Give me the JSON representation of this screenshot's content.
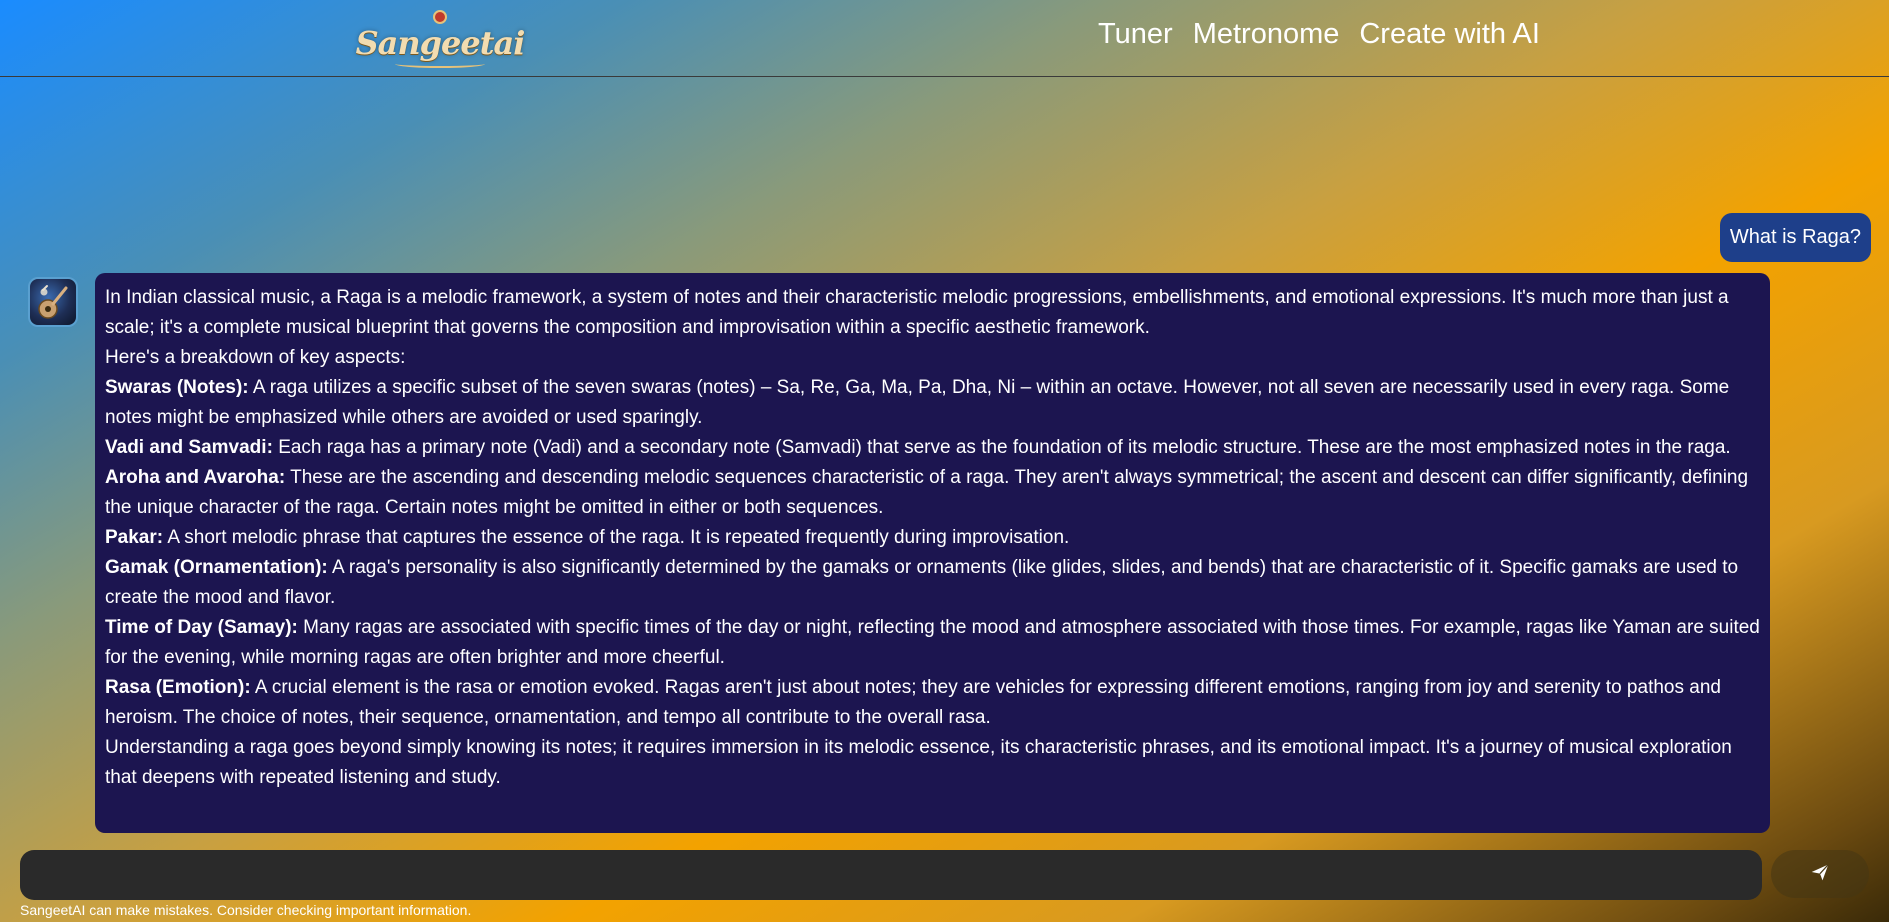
{
  "header": {
    "logo_text": "Sangeetai",
    "nav": [
      {
        "label": "Tuner"
      },
      {
        "label": "Metronome"
      },
      {
        "label": "Create with AI"
      }
    ]
  },
  "chat": {
    "user_message": "What is Raga?",
    "assistant": {
      "avatar_icon": "veena-avatar-icon",
      "intro": "In Indian classical music, a Raga is a melodic framework, a system of notes and their characteristic melodic progressions, embellishments, and emotional expressions. It's much more than just a scale; it's a complete musical blueprint that governs the composition and improvisation within a specific aesthetic framework.",
      "lead": "Here's a breakdown of key aspects:",
      "points": [
        {
          "term": "Swaras (Notes):",
          "text": "A raga utilizes a specific subset of the seven swaras (notes) – Sa, Re, Ga, Ma, Pa, Dha, Ni – within an octave. However, not all seven are necessarily used in every raga. Some notes might be emphasized while others are avoided or used sparingly."
        },
        {
          "term": "Vadi and Samvadi:",
          "text": "Each raga has a primary note (Vadi) and a secondary note (Samvadi) that serve as the foundation of its melodic structure. These are the most emphasized notes in the raga."
        },
        {
          "term": "Aroha and Avaroha:",
          "text": "These are the ascending and descending melodic sequences characteristic of a raga. They aren't always symmetrical; the ascent and descent can differ significantly, defining the unique character of the raga. Certain notes might be omitted in either or both sequences."
        },
        {
          "term": "Pakar:",
          "text": "A short melodic phrase that captures the essence of the raga. It is repeated frequently during improvisation."
        },
        {
          "term": "Gamak (Ornamentation):",
          "text": "A raga's personality is also significantly determined by the gamaks or ornaments (like glides, slides, and bends) that are characteristic of it. Specific gamaks are used to create the mood and flavor."
        },
        {
          "term": "Time of Day (Samay):",
          "text": "Many ragas are associated with specific times of the day or night, reflecting the mood and atmosphere associated with those times. For example, ragas like Yaman are suited for the evening, while morning ragas are often brighter and more cheerful."
        },
        {
          "term": "Rasa (Emotion):",
          "text": "A crucial element is the rasa or emotion evoked. Ragas aren't just about notes; they are vehicles for expressing different emotions, ranging from joy and serenity to pathos and heroism. The choice of notes, their sequence, ornamentation, and tempo all contribute to the overall rasa."
        }
      ],
      "conclusion": "Understanding a raga goes beyond simply knowing its notes; it requires immersion in its melodic essence, its characteristic phrases, and its emotional impact. It's a journey of musical exploration that deepens with repeated listening and study."
    }
  },
  "composer": {
    "input_value": "",
    "input_placeholder": "",
    "send_icon": "send-icon",
    "disclaimer": "SangeetAI can make mistakes. Consider checking important information."
  },
  "colors": {
    "header_border": "#3a3a3a",
    "user_bubble": "#1e3f8a",
    "assistant_bubble": "#1c1550",
    "input_bg": "#2a2a2a"
  }
}
